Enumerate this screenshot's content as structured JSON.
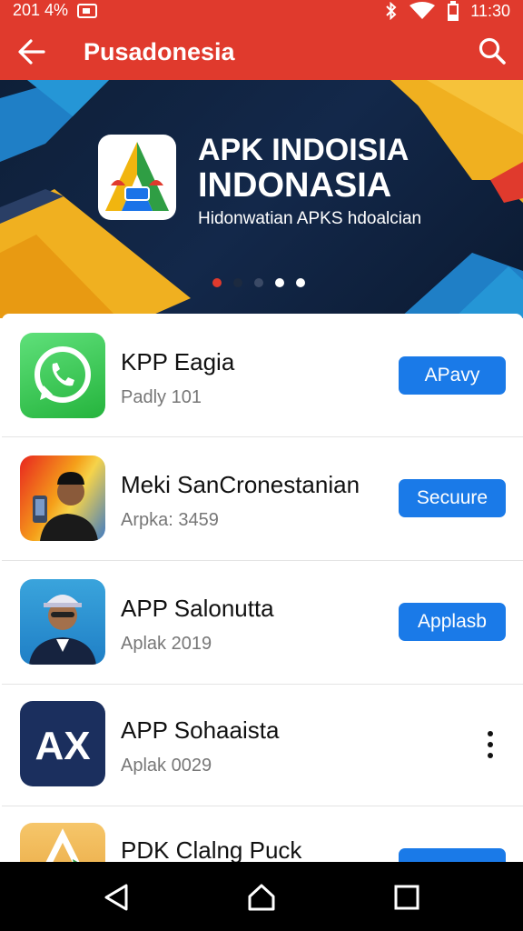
{
  "status_bar": {
    "left_text": "201 4%",
    "time": "11:30",
    "icons": [
      "notification-icon",
      "bluetooth-icon",
      "wifi-icon",
      "battery-icon"
    ]
  },
  "app_bar": {
    "title": "Pusadonesia",
    "back_icon": "arrow-left-icon",
    "search_icon": "search-icon",
    "background": "#e03a2d"
  },
  "banner": {
    "line1": "APK INDOISIA",
    "line2": "INDONASIA",
    "subtitle": "Hidonwatian APKS hdoalcian",
    "dots_total": 5,
    "dots_active_red": 0
  },
  "apps": [
    {
      "name": "KPP Eagia",
      "meta": "Padly 101",
      "action": "APavy",
      "icon": "whatsapp-icon"
    },
    {
      "name": "Meki SanCronestanian",
      "meta": "Arpka: 3459",
      "action": "Secuure",
      "icon": "person-photo-icon"
    },
    {
      "name": "APP Salonutta",
      "meta": "Aplak 2019",
      "action": "Applasb",
      "icon": "person-cap-photo-icon"
    },
    {
      "name": "APP Sohaaista",
      "meta": "Aplak 0029",
      "action": "",
      "icon": "ax-logo-icon",
      "icon_text": "AX"
    },
    {
      "name": "PDK Clalng Puck",
      "meta": "",
      "action": "",
      "icon": "triangle-logo-icon"
    }
  ],
  "colors": {
    "accent": "#e03a2d",
    "button": "#1a7ae8"
  }
}
